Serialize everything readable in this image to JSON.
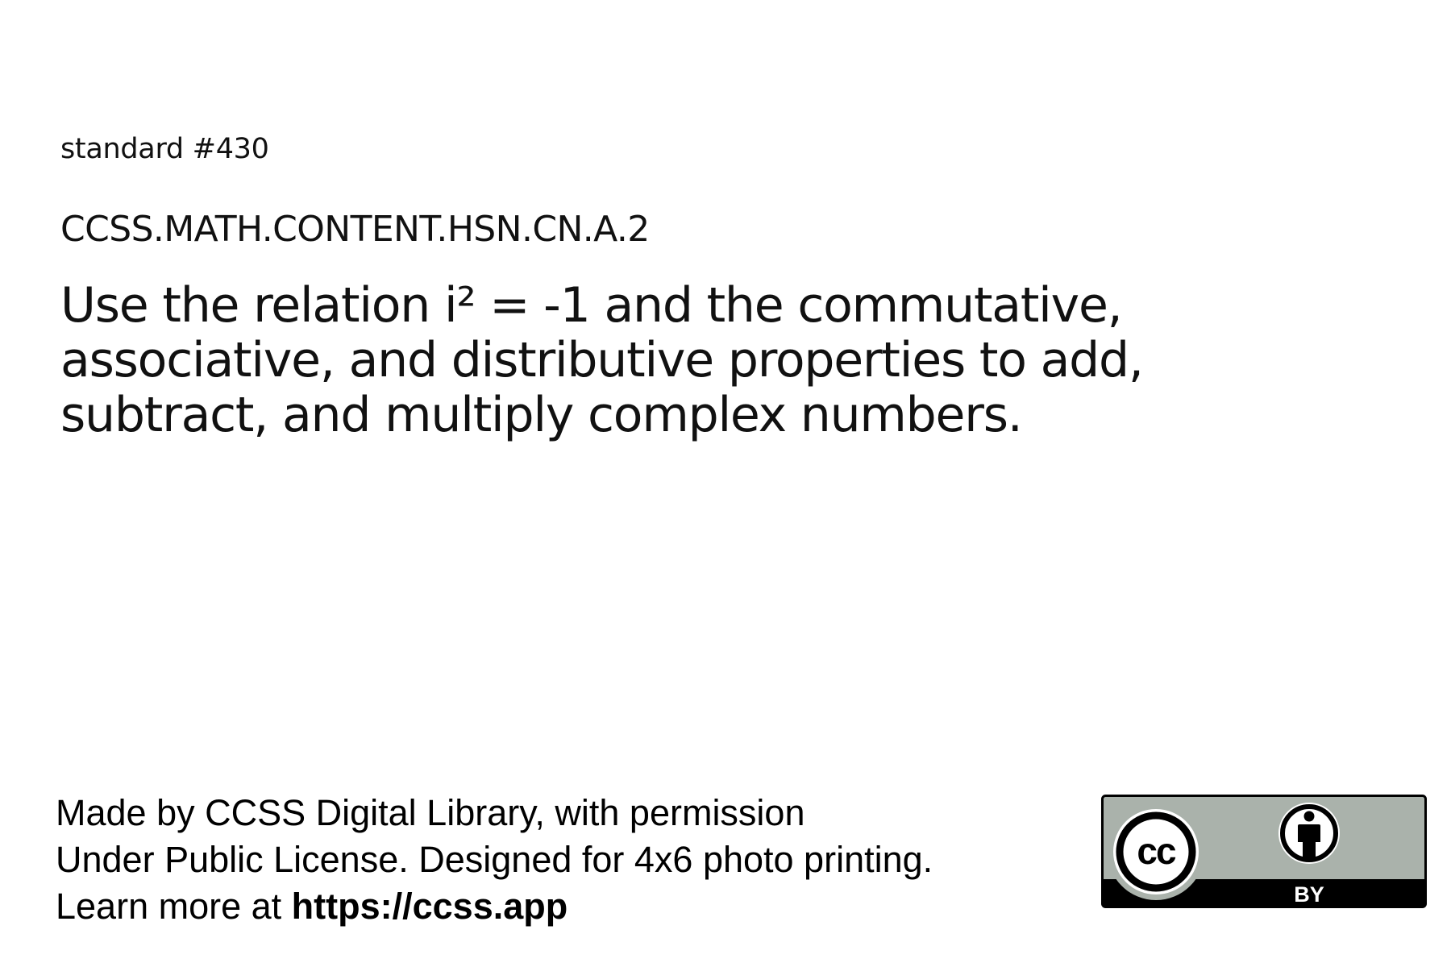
{
  "card": {
    "standard_number": "standard #430",
    "standard_code": "CCSS.MATH.CONTENT.HSN.CN.A.2",
    "standard_text_lines": [
      "Use the relation i² = -1 and the commutative,",
      "associative, and distributive properties to add,",
      "subtract, and multiply complex numbers."
    ]
  },
  "footer": {
    "line1": "Made by CCSS Digital Library, with permission",
    "line2": "Under Public License. Designed for 4x6 photo printing.",
    "line3_prefix": "Learn more at ",
    "line3_link": "https://ccss.app"
  },
  "license_badge": {
    "cc_label": "cc",
    "by_label": "BY",
    "icons": [
      "cc-icon",
      "attribution-person-icon"
    ],
    "colors": {
      "panel": "#aab2ab",
      "border": "#000000",
      "circle_fill": "#ffffff",
      "text": "#ffffff"
    }
  }
}
